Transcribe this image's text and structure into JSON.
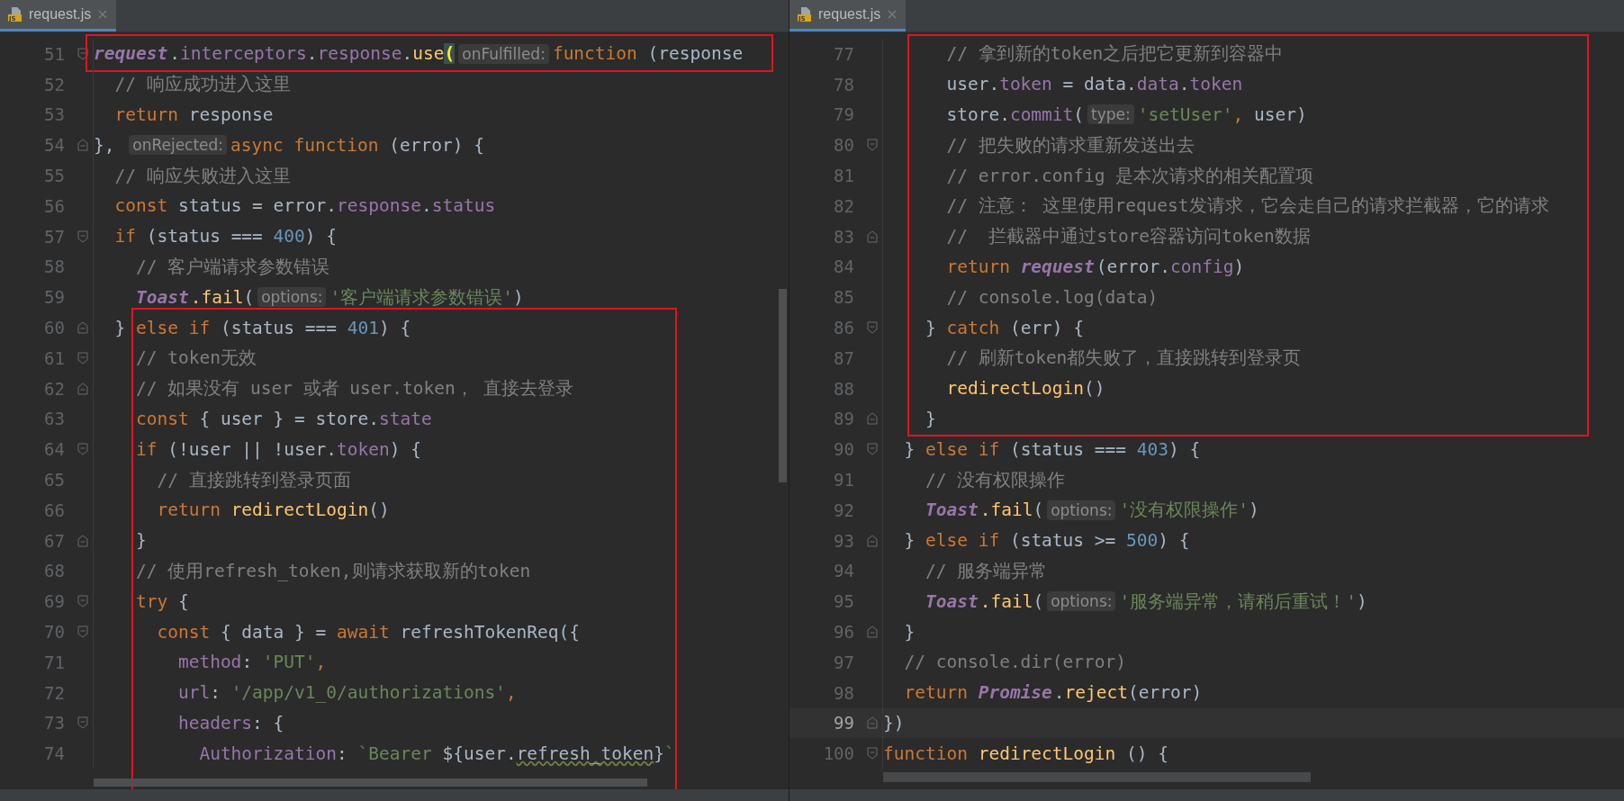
{
  "panes": [
    {
      "tab": {
        "label": "request.js",
        "icon_label": "JS",
        "selected": true
      },
      "blocks": [
        {
          "framed": true,
          "lines": [
            {
              "no": "51",
              "fold_start": true,
              "fold_end": false,
              "current": false,
              "tokens": [
                {
                  "kind": "glob",
                  "text": "request"
                },
                {
                  "kind": "plain",
                  "text": "."
                },
                {
                  "kind": "prop",
                  "text": "interceptors"
                },
                {
                  "kind": "plain",
                  "text": "."
                },
                {
                  "kind": "prop",
                  "text": "response"
                },
                {
                  "kind": "plain",
                  "text": "."
                },
                {
                  "kind": "fn",
                  "text": "use"
                },
                {
                  "kind": "brace",
                  "text": "("
                },
                {
                  "kind": "hint",
                  "text": "onFulfilled:"
                },
                {
                  "kind": "kw",
                  "text": "function"
                },
                {
                  "kind": "plain",
                  "text": " (response"
                }
              ]
            }
          ]
        },
        {
          "framed": false,
          "lines": [
            {
              "no": "52",
              "fold_start": false,
              "fold_end": false,
              "current": false,
              "tokens": [
                {
                  "kind": "cm",
                  "text": "  // 响应成功进入这里"
                }
              ]
            },
            {
              "no": "53",
              "fold_start": false,
              "fold_end": false,
              "current": false,
              "tokens": [
                {
                  "kind": "kw",
                  "text": "  return"
                },
                {
                  "kind": "plain",
                  "text": " response"
                }
              ]
            },
            {
              "no": "54",
              "fold_start": false,
              "fold_end": true,
              "current": false,
              "tokens": [
                {
                  "kind": "plain",
                  "text": "}, "
                },
                {
                  "kind": "hint",
                  "text": "onRejected:"
                },
                {
                  "kind": "kw",
                  "text": "async function"
                },
                {
                  "kind": "plain",
                  "text": " (error) {"
                }
              ]
            },
            {
              "no": "55",
              "fold_start": false,
              "fold_end": false,
              "current": false,
              "tokens": [
                {
                  "kind": "cm",
                  "text": "  // 响应失败进入这里"
                }
              ]
            },
            {
              "no": "56",
              "fold_start": false,
              "fold_end": false,
              "current": false,
              "tokens": [
                {
                  "kind": "kw",
                  "text": "  const"
                },
                {
                  "kind": "plain",
                  "text": " status = error."
                },
                {
                  "kind": "prop",
                  "text": "response"
                },
                {
                  "kind": "plain",
                  "text": "."
                },
                {
                  "kind": "prop",
                  "text": "status"
                }
              ]
            },
            {
              "no": "57",
              "fold_start": true,
              "fold_end": false,
              "current": false,
              "tokens": [
                {
                  "kind": "kw",
                  "text": "  if"
                },
                {
                  "kind": "plain",
                  "text": " (status === "
                },
                {
                  "kind": "num",
                  "text": "400"
                },
                {
                  "kind": "plain",
                  "text": ") {"
                }
              ]
            },
            {
              "no": "58",
              "fold_start": false,
              "fold_end": false,
              "current": false,
              "tokens": [
                {
                  "kind": "cm",
                  "text": "    // 客户端请求参数错误"
                }
              ]
            },
            {
              "no": "59",
              "fold_start": false,
              "fold_end": false,
              "current": false,
              "tokens": [
                {
                  "kind": "glob",
                  "text": "    Toast"
                },
                {
                  "kind": "fn",
                  "text": ".fail"
                },
                {
                  "kind": "plain",
                  "text": "("
                },
                {
                  "kind": "hint",
                  "text": "options:"
                },
                {
                  "kind": "str",
                  "text": "'客户端请求参数错误'"
                },
                {
                  "kind": "plain",
                  "text": ")"
                }
              ]
            }
          ]
        },
        {
          "framed": true,
          "lines": [
            {
              "no": "60",
              "fold_start": false,
              "fold_end": true,
              "current": false,
              "tokens": [
                {
                  "kind": "plain",
                  "text": "  } "
                },
                {
                  "kind": "kw",
                  "text": "else if"
                },
                {
                  "kind": "plain",
                  "text": " (status === "
                },
                {
                  "kind": "num",
                  "text": "401"
                },
                {
                  "kind": "plain",
                  "text": ") {"
                }
              ]
            },
            {
              "no": "61",
              "fold_start": true,
              "fold_end": false,
              "current": false,
              "tokens": [
                {
                  "kind": "cm",
                  "text": "    // token无效"
                }
              ]
            },
            {
              "no": "62",
              "fold_start": false,
              "fold_end": true,
              "current": false,
              "tokens": [
                {
                  "kind": "cm",
                  "text": "    // 如果没有 user 或者 user.token， 直接去登录"
                }
              ]
            },
            {
              "no": "63",
              "fold_start": false,
              "fold_end": false,
              "current": false,
              "tokens": [
                {
                  "kind": "kw",
                  "text": "    const"
                },
                {
                  "kind": "plain",
                  "text": " { user } = store."
                },
                {
                  "kind": "prop",
                  "text": "state"
                }
              ]
            },
            {
              "no": "64",
              "fold_start": true,
              "fold_end": false,
              "current": false,
              "tokens": [
                {
                  "kind": "kw",
                  "text": "    if"
                },
                {
                  "kind": "plain",
                  "text": " (!user || !user."
                },
                {
                  "kind": "prop",
                  "text": "token"
                },
                {
                  "kind": "plain",
                  "text": ") {"
                }
              ]
            },
            {
              "no": "65",
              "fold_start": false,
              "fold_end": false,
              "current": false,
              "tokens": [
                {
                  "kind": "cm",
                  "text": "      // 直接跳转到登录页面"
                }
              ]
            },
            {
              "no": "66",
              "fold_start": false,
              "fold_end": false,
              "current": false,
              "tokens": [
                {
                  "kind": "kw",
                  "text": "      return "
                },
                {
                  "kind": "fn",
                  "text": "redirectLogin"
                },
                {
                  "kind": "plain",
                  "text": "()"
                }
              ]
            },
            {
              "no": "67",
              "fold_start": false,
              "fold_end": true,
              "current": false,
              "tokens": [
                {
                  "kind": "plain",
                  "text": "    }"
                }
              ]
            },
            {
              "no": "68",
              "fold_start": false,
              "fold_end": false,
              "current": false,
              "tokens": [
                {
                  "kind": "cm",
                  "text": "    // 使用refresh_token,则请求获取新的token"
                }
              ]
            },
            {
              "no": "69",
              "fold_start": true,
              "fold_end": false,
              "current": false,
              "tokens": [
                {
                  "kind": "kw",
                  "text": "    try"
                },
                {
                  "kind": "plain",
                  "text": " {"
                }
              ]
            },
            {
              "no": "70",
              "fold_start": true,
              "fold_end": false,
              "current": false,
              "tokens": [
                {
                  "kind": "kw",
                  "text": "      const"
                },
                {
                  "kind": "plain",
                  "text": " { data } = "
                },
                {
                  "kind": "kw",
                  "text": "await"
                },
                {
                  "kind": "plain",
                  "text": " refreshTokenReq({"
                }
              ]
            },
            {
              "no": "71",
              "fold_start": false,
              "fold_end": false,
              "current": false,
              "tokens": [
                {
                  "kind": "prop",
                  "text": "        method"
                },
                {
                  "kind": "plain",
                  "text": ": "
                },
                {
                  "kind": "str",
                  "text": "'PUT'"
                },
                {
                  "kind": "kw",
                  "text": ","
                }
              ]
            },
            {
              "no": "72",
              "fold_start": false,
              "fold_end": false,
              "current": false,
              "tokens": [
                {
                  "kind": "prop",
                  "text": "        url"
                },
                {
                  "kind": "plain",
                  "text": ": "
                },
                {
                  "kind": "str",
                  "text": "'/app/v1_0/authorizations'"
                },
                {
                  "kind": "kw",
                  "text": ","
                }
              ]
            },
            {
              "no": "73",
              "fold_start": true,
              "fold_end": false,
              "current": false,
              "tokens": [
                {
                  "kind": "prop",
                  "text": "        headers"
                },
                {
                  "kind": "plain",
                  "text": ": {"
                }
              ]
            },
            {
              "no": "74",
              "fold_start": false,
              "fold_end": false,
              "current": false,
              "tokens": [
                {
                  "kind": "prop",
                  "text": "          Authorization"
                },
                {
                  "kind": "plain",
                  "text": ": "
                },
                {
                  "kind": "str",
                  "text": "`Bearer "
                },
                {
                  "kind": "plain",
                  "text": "${user."
                },
                {
                  "kind": "typo",
                  "text": "refresh_token"
                },
                {
                  "kind": "plain",
                  "text": "}"
                },
                {
                  "kind": "str",
                  "text": "`"
                }
              ]
            }
          ]
        }
      ]
    },
    {
      "tab": {
        "label": "request.js",
        "icon_label": "JS",
        "selected": true
      },
      "blocks": [
        {
          "framed": true,
          "lines": [
            {
              "no": "77",
              "fold_start": false,
              "fold_end": false,
              "current": false,
              "tokens": [
                {
                  "kind": "cm",
                  "text": "      // 拿到新的token之后把它更新到容器中"
                }
              ]
            },
            {
              "no": "78",
              "fold_start": false,
              "fold_end": false,
              "current": false,
              "tokens": [
                {
                  "kind": "plain",
                  "text": "      user."
                },
                {
                  "kind": "prop",
                  "text": "token"
                },
                {
                  "kind": "plain",
                  "text": " = data."
                },
                {
                  "kind": "prop",
                  "text": "data"
                },
                {
                  "kind": "plain",
                  "text": "."
                },
                {
                  "kind": "prop",
                  "text": "token"
                }
              ]
            },
            {
              "no": "79",
              "fold_start": false,
              "fold_end": false,
              "current": false,
              "tokens": [
                {
                  "kind": "plain",
                  "text": "      store."
                },
                {
                  "kind": "prop",
                  "text": "commit"
                },
                {
                  "kind": "plain",
                  "text": "("
                },
                {
                  "kind": "hint",
                  "text": "type:"
                },
                {
                  "kind": "str",
                  "text": "'setUser'"
                },
                {
                  "kind": "kw",
                  "text": ","
                },
                {
                  "kind": "plain",
                  "text": " user)"
                }
              ]
            },
            {
              "no": "80",
              "fold_start": true,
              "fold_end": false,
              "current": false,
              "tokens": [
                {
                  "kind": "cm",
                  "text": "      // 把失败的请求重新发送出去"
                }
              ]
            },
            {
              "no": "81",
              "fold_start": false,
              "fold_end": false,
              "current": false,
              "tokens": [
                {
                  "kind": "cm",
                  "text": "      // error.config 是本次请求的相关配置项"
                }
              ]
            },
            {
              "no": "82",
              "fold_start": false,
              "fold_end": false,
              "current": false,
              "tokens": [
                {
                  "kind": "cm",
                  "text": "      // 注意： 这里使用request发请求，它会走自己的请求拦截器，它的请求"
                }
              ]
            },
            {
              "no": "83",
              "fold_start": false,
              "fold_end": true,
              "current": false,
              "tokens": [
                {
                  "kind": "cm",
                  "text": "      //  拦截器中通过store容器访问token数据"
                }
              ]
            },
            {
              "no": "84",
              "fold_start": false,
              "fold_end": false,
              "current": false,
              "tokens": [
                {
                  "kind": "kw",
                  "text": "      return "
                },
                {
                  "kind": "glob",
                  "text": "request"
                },
                {
                  "kind": "plain",
                  "text": "(error."
                },
                {
                  "kind": "prop",
                  "text": "config"
                },
                {
                  "kind": "plain",
                  "text": ")"
                }
              ]
            },
            {
              "no": "85",
              "fold_start": false,
              "fold_end": false,
              "current": false,
              "tokens": [
                {
                  "kind": "cm",
                  "text": "      // console.log(data)"
                }
              ]
            },
            {
              "no": "86",
              "fold_start": true,
              "fold_end": false,
              "current": false,
              "tokens": [
                {
                  "kind": "plain",
                  "text": "    } "
                },
                {
                  "kind": "kw",
                  "text": "catch"
                },
                {
                  "kind": "plain",
                  "text": " (err) {"
                }
              ]
            },
            {
              "no": "87",
              "fold_start": false,
              "fold_end": false,
              "current": false,
              "tokens": [
                {
                  "kind": "cm",
                  "text": "      // 刷新token都失败了，直接跳转到登录页"
                }
              ]
            },
            {
              "no": "88",
              "fold_start": false,
              "fold_end": false,
              "current": false,
              "tokens": [
                {
                  "kind": "fn",
                  "text": "      redirectLogin"
                },
                {
                  "kind": "plain",
                  "text": "()"
                }
              ]
            },
            {
              "no": "89",
              "fold_start": false,
              "fold_end": true,
              "current": false,
              "tokens": [
                {
                  "kind": "plain",
                  "text": "    }"
                }
              ]
            }
          ]
        },
        {
          "framed": false,
          "lines": [
            {
              "no": "90",
              "fold_start": true,
              "fold_end": false,
              "current": false,
              "tokens": [
                {
                  "kind": "plain",
                  "text": "  } "
                },
                {
                  "kind": "kw",
                  "text": "else if"
                },
                {
                  "kind": "plain",
                  "text": " (status === "
                },
                {
                  "kind": "num",
                  "text": "403"
                },
                {
                  "kind": "plain",
                  "text": ") {"
                }
              ]
            },
            {
              "no": "91",
              "fold_start": false,
              "fold_end": false,
              "current": false,
              "tokens": [
                {
                  "kind": "cm",
                  "text": "    // 没有权限操作"
                }
              ]
            },
            {
              "no": "92",
              "fold_start": false,
              "fold_end": false,
              "current": false,
              "tokens": [
                {
                  "kind": "glob",
                  "text": "    Toast"
                },
                {
                  "kind": "fn",
                  "text": ".fail"
                },
                {
                  "kind": "plain",
                  "text": "("
                },
                {
                  "kind": "hint",
                  "text": "options:"
                },
                {
                  "kind": "str",
                  "text": "'没有权限操作'"
                },
                {
                  "kind": "plain",
                  "text": ")"
                }
              ]
            },
            {
              "no": "93",
              "fold_start": false,
              "fold_end": true,
              "current": false,
              "tokens": [
                {
                  "kind": "plain",
                  "text": "  } "
                },
                {
                  "kind": "kw",
                  "text": "else if"
                },
                {
                  "kind": "plain",
                  "text": " (status >= "
                },
                {
                  "kind": "num",
                  "text": "500"
                },
                {
                  "kind": "plain",
                  "text": ") {"
                }
              ]
            },
            {
              "no": "94",
              "fold_start": false,
              "fold_end": false,
              "current": false,
              "tokens": [
                {
                  "kind": "cm",
                  "text": "    // 服务端异常"
                }
              ]
            },
            {
              "no": "95",
              "fold_start": false,
              "fold_end": false,
              "current": false,
              "tokens": [
                {
                  "kind": "glob",
                  "text": "    Toast"
                },
                {
                  "kind": "fn",
                  "text": ".fail"
                },
                {
                  "kind": "plain",
                  "text": "("
                },
                {
                  "kind": "hint",
                  "text": "options:"
                },
                {
                  "kind": "str",
                  "text": "'服务端异常，请稍后重试！'"
                },
                {
                  "kind": "plain",
                  "text": ")"
                }
              ]
            },
            {
              "no": "96",
              "fold_start": false,
              "fold_end": true,
              "current": false,
              "tokens": [
                {
                  "kind": "plain",
                  "text": "  }"
                }
              ]
            },
            {
              "no": "97",
              "fold_start": false,
              "fold_end": false,
              "current": false,
              "tokens": [
                {
                  "kind": "cm",
                  "text": "  // console.dir(error)"
                }
              ]
            },
            {
              "no": "98",
              "fold_start": false,
              "fold_end": false,
              "current": false,
              "tokens": [
                {
                  "kind": "kw",
                  "text": "  return "
                },
                {
                  "kind": "glob",
                  "text": "Promise"
                },
                {
                  "kind": "plain",
                  "text": "."
                },
                {
                  "kind": "fn",
                  "text": "reject"
                },
                {
                  "kind": "plain",
                  "text": "(error)"
                }
              ]
            },
            {
              "no": "99",
              "fold_start": false,
              "fold_end": true,
              "current": true,
              "tokens": [
                {
                  "kind": "plain",
                  "text": "})"
                }
              ]
            },
            {
              "no": "100",
              "fold_start": true,
              "fold_end": false,
              "current": false,
              "tokens": [
                {
                  "kind": "kw",
                  "text": "function "
                },
                {
                  "kind": "fn",
                  "text": "redirectLogin"
                },
                {
                  "kind": "plain",
                  "text": " () {"
                }
              ]
            }
          ]
        }
      ]
    }
  ]
}
